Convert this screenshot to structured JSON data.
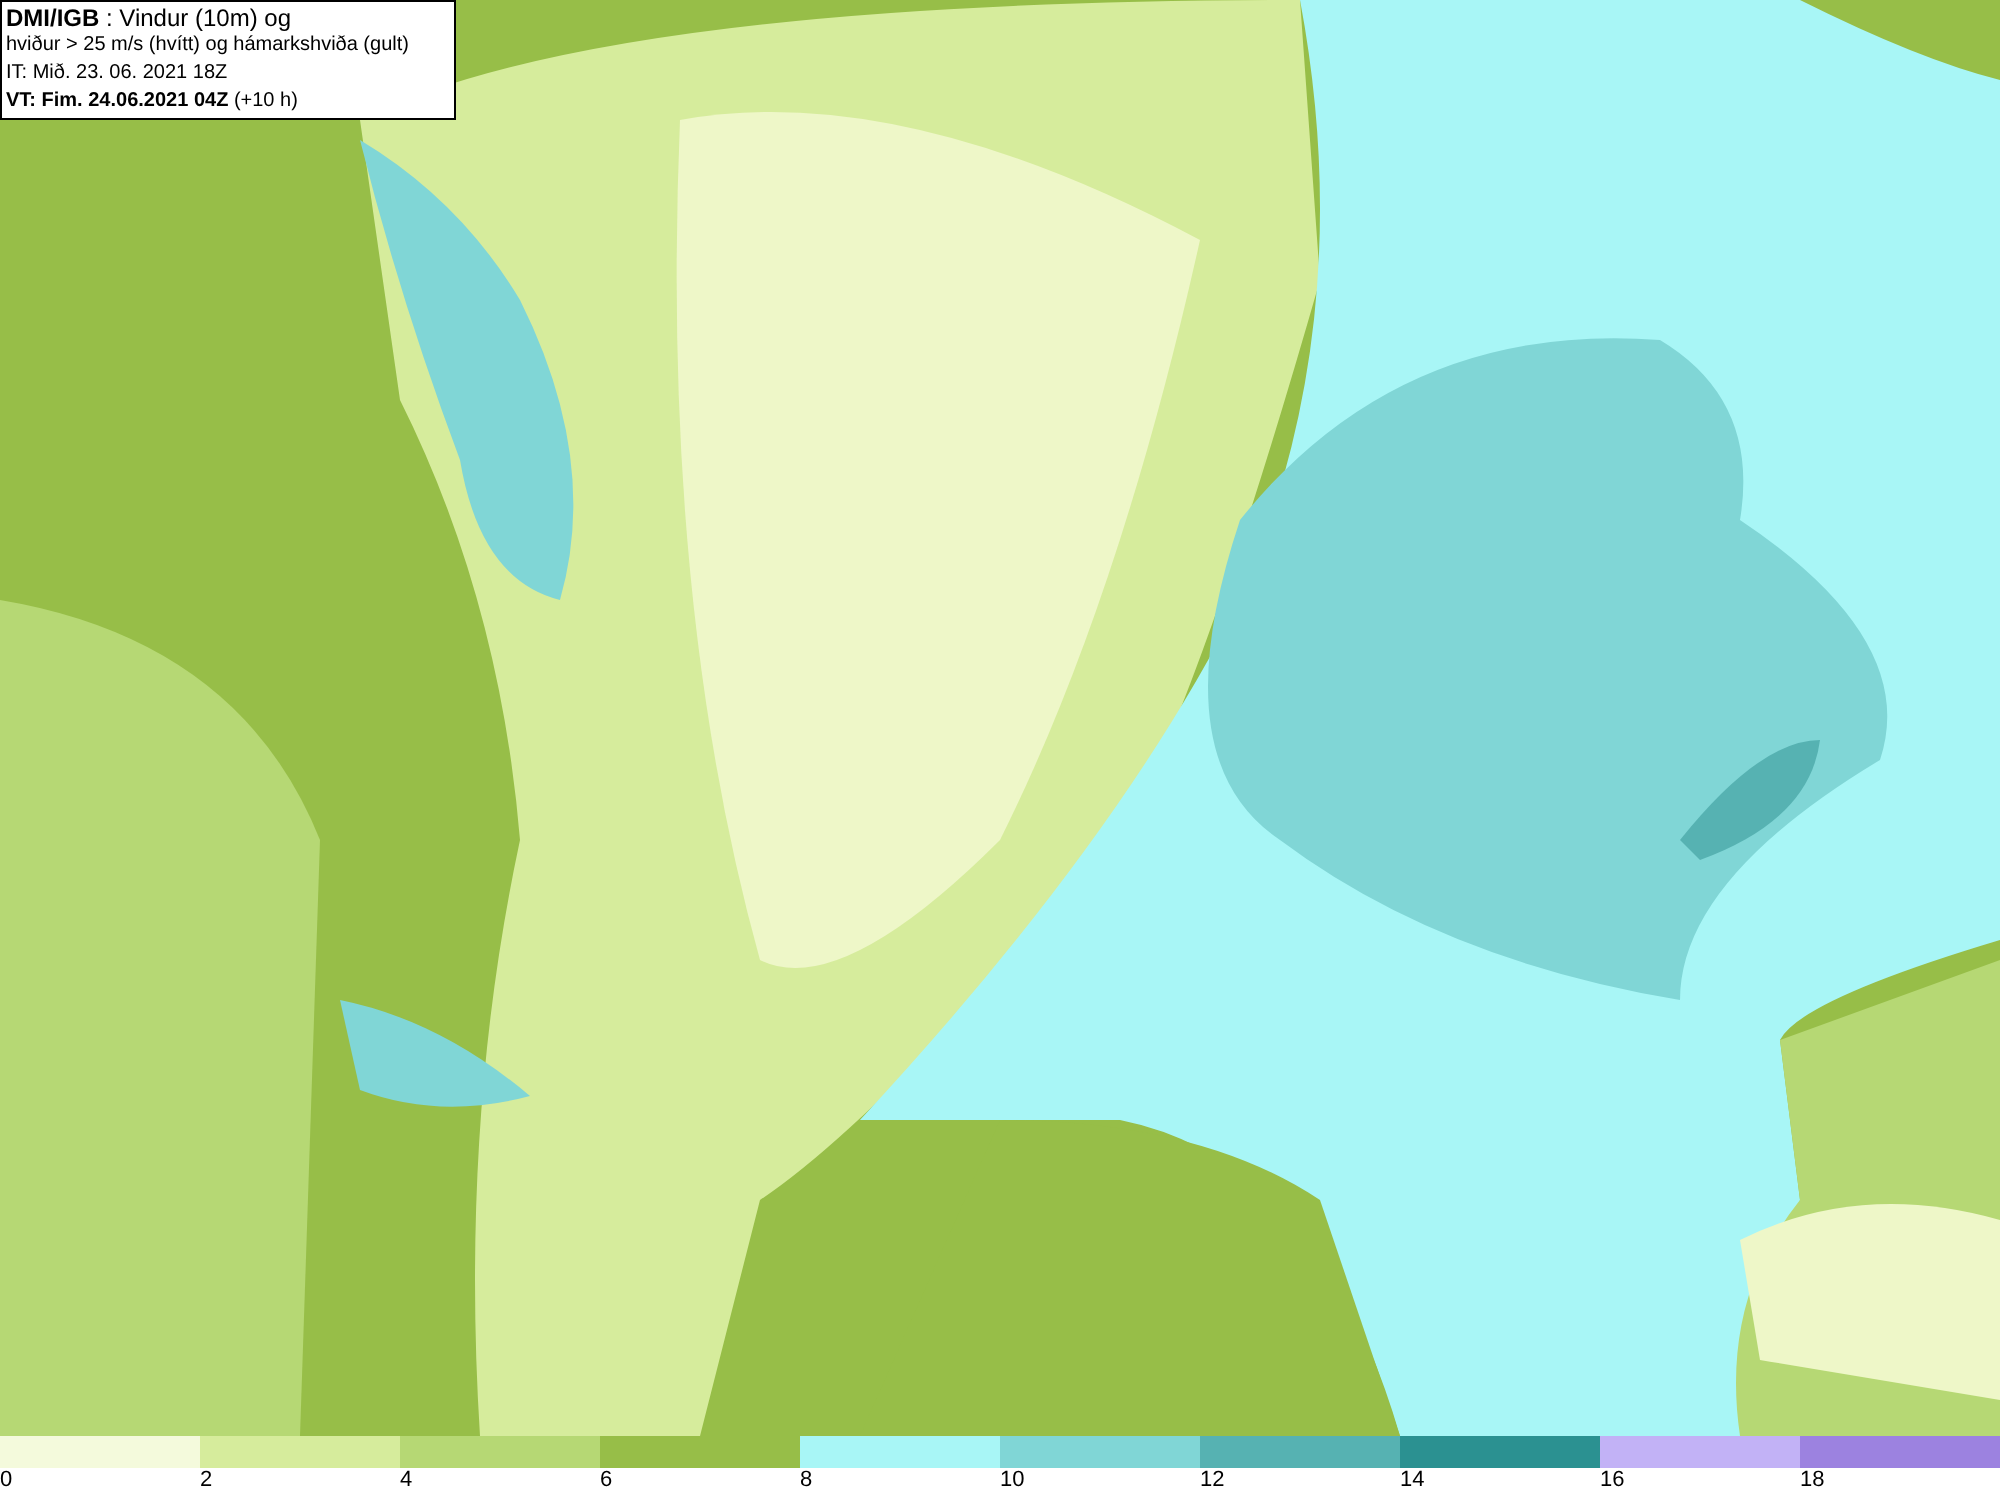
{
  "title_box": {
    "lines": [
      "**DMI/IGB** : Vindur (10m) og",
      "hviður > 25 m/s (hvítt) og hámarkshviða (gult)",
      "IT: Mið. 23. 06. 2021 18Z",
      "**VT: Fim. 24.06.2021 04Z** (+10 h)"
    ]
  },
  "colorbar": {
    "segments": [
      {
        "color": "#f4fadc"
      },
      {
        "color": "#d6ec9c"
      },
      {
        "color": "#b6d874"
      },
      {
        "color": "#97be48"
      },
      {
        "color": "#a8f6f6"
      },
      {
        "color": "#80d6d6"
      },
      {
        "color": "#56b2b2"
      },
      {
        "color": "#2b9191"
      },
      {
        "color": "#c2b2f6"
      },
      {
        "color": "#9c82e0"
      }
    ],
    "ticks": [
      "0",
      "2",
      "4",
      "6",
      "8",
      "10",
      "12",
      "14",
      "16",
      "18"
    ]
  }
}
